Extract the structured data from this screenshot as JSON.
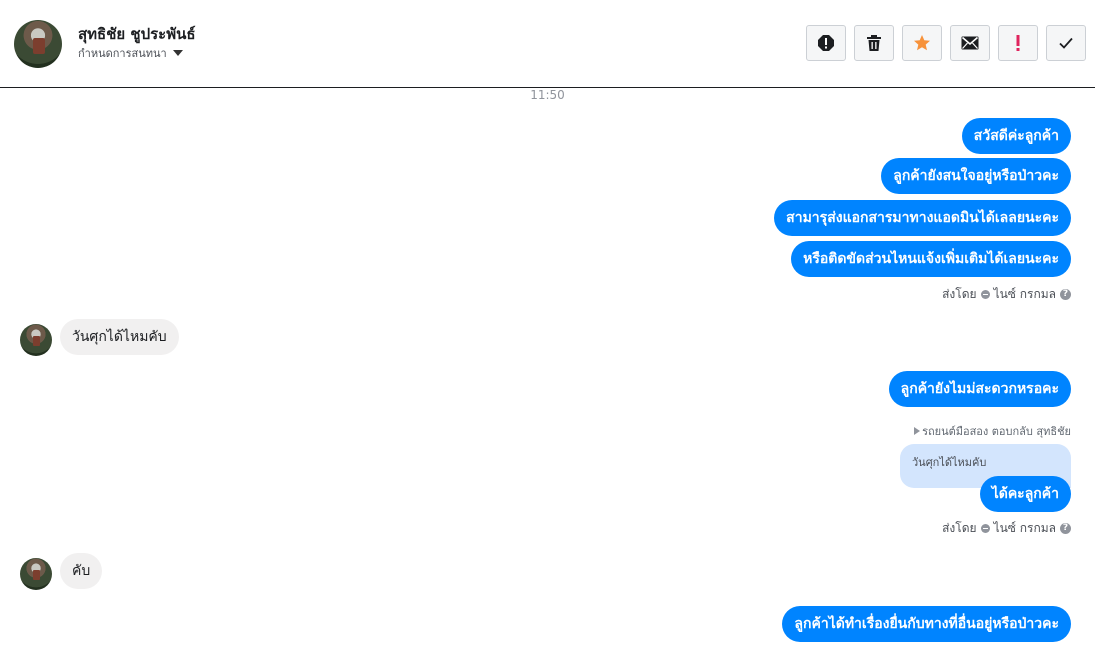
{
  "header": {
    "user_name": "สุทธิชัย ชูประพันธ์",
    "assign_label": "กำหนดการสนทนา",
    "actions": [
      {
        "name": "report-icon"
      },
      {
        "name": "trash-icon"
      },
      {
        "name": "star-icon",
        "color": "#f7923b"
      },
      {
        "name": "envelope-icon"
      },
      {
        "name": "exclamation-icon",
        "color": "#e0245e"
      },
      {
        "name": "checkmark-icon"
      }
    ]
  },
  "conversation": {
    "time_divider": "11:50",
    "group1": [
      "สวัสดีค่ะลูกค้า",
      "ลูกค้ายังสนใจอยู่หรือป่าวคะ",
      "สามารุส่งแอกสารมาทางแอดมินได้เลลยนะคะ",
      "หรือติดขัดส่วนไหนแจ้งเพิ่มเติมได้เลยนะคะ"
    ],
    "sent_by_1": {
      "prefix": "ส่งโดย",
      "name": "ไนซ์ กรกมล"
    },
    "incoming1": "วันศุกได้ไหมคับ",
    "outgoing2": "ลูกค้ายังไมม่สะดวกหรอคะ",
    "reply_note": "รถยนต์มือสอง ตอบกลับ สุทธิชัย",
    "quoted_text": "วันศุกได้ไหมคับ",
    "reply_bubble": "ได้คะลูกค้า",
    "sent_by_2": {
      "prefix": "ส่งโดย",
      "name": "ไนซ์ กรกมล"
    },
    "incoming2": "คับ",
    "outgoing3": "ลูกค้าได้ทำเรื่องยื่นกับทางที่อื่นอยู่หรือป่าวคะ"
  }
}
